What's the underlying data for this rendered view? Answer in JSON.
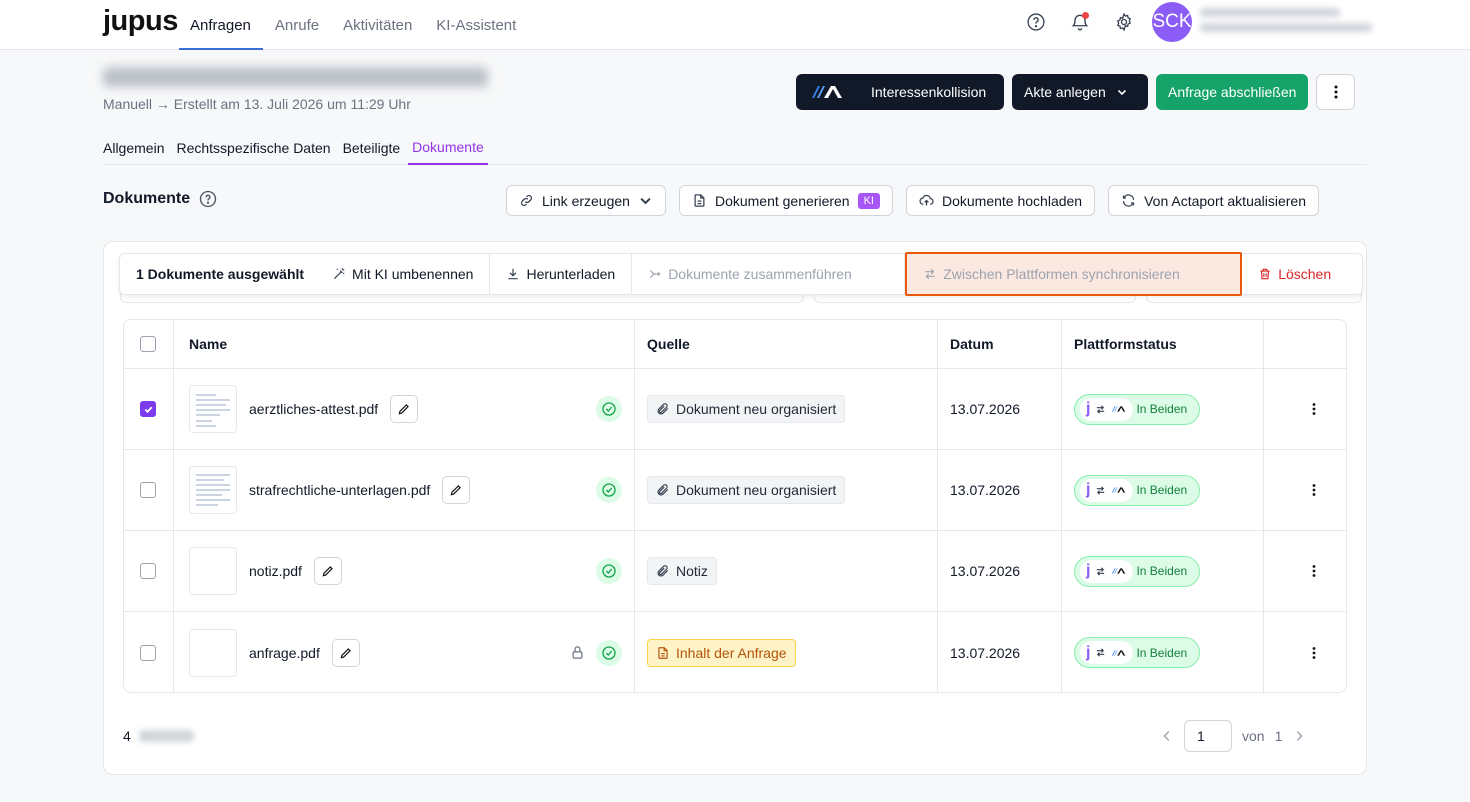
{
  "app": {
    "logo": "jupus"
  },
  "nav": {
    "items": [
      "Anfragen",
      "Anrufe",
      "Aktivitäten",
      "KI-Assistent"
    ],
    "active": "Anfragen"
  },
  "user": {
    "initials": "SCK"
  },
  "header": {
    "subtitle": "Manuell → Erstellt am 13. Juli 2026 um 11:29 Uhr",
    "btn_conflict": "Interessenkollision",
    "btn_akte": "Akte anlegen",
    "btn_close": "Anfrage abschließen"
  },
  "subtabs": [
    "Allgemein",
    "Rechtsspezifische Daten",
    "Beteiligte",
    "Dokumente"
  ],
  "documents": {
    "title": "Dokumente",
    "btn_link": "Link erzeugen",
    "btn_generate": "Dokument generieren",
    "ki_badge": "KI",
    "btn_upload": "Dokumente hochladen",
    "btn_actaport": "Von Actaport aktualisieren"
  },
  "selection": {
    "count": "1 Dokumente ausgewählt",
    "rename": "Mit KI umbenennen",
    "download": "Herunterladen",
    "merge": "Dokumente zusammenführen",
    "sync": "Zwischen Plattformen synchronisieren",
    "delete": "Löschen"
  },
  "table": {
    "headers": {
      "name": "Name",
      "source": "Quelle",
      "date": "Datum",
      "status": "Plattformstatus"
    },
    "rows": [
      {
        "name": "aerztliches-attest.pdf",
        "source": "Dokument neu organisiert",
        "date": "13.07.2026",
        "status": "In Beiden",
        "checked": true,
        "thumb": true,
        "locked": false,
        "source_style": "gray"
      },
      {
        "name": "strafrechtliche-unterlagen.pdf",
        "source": "Dokument neu organisiert",
        "date": "13.07.2026",
        "status": "In Beiden",
        "checked": false,
        "thumb": true,
        "locked": false,
        "source_style": "gray"
      },
      {
        "name": "notiz.pdf",
        "source": "Notiz",
        "date": "13.07.2026",
        "status": "In Beiden",
        "checked": false,
        "thumb": false,
        "locked": false,
        "source_style": "gray"
      },
      {
        "name": "anfrage.pdf",
        "source": "Inhalt der Anfrage",
        "date": "13.07.2026",
        "status": "In Beiden",
        "checked": false,
        "thumb": false,
        "locked": true,
        "source_style": "orange"
      }
    ]
  },
  "footer": {
    "count": "4",
    "page": "1",
    "of_label": "von",
    "total_pages": "1"
  }
}
